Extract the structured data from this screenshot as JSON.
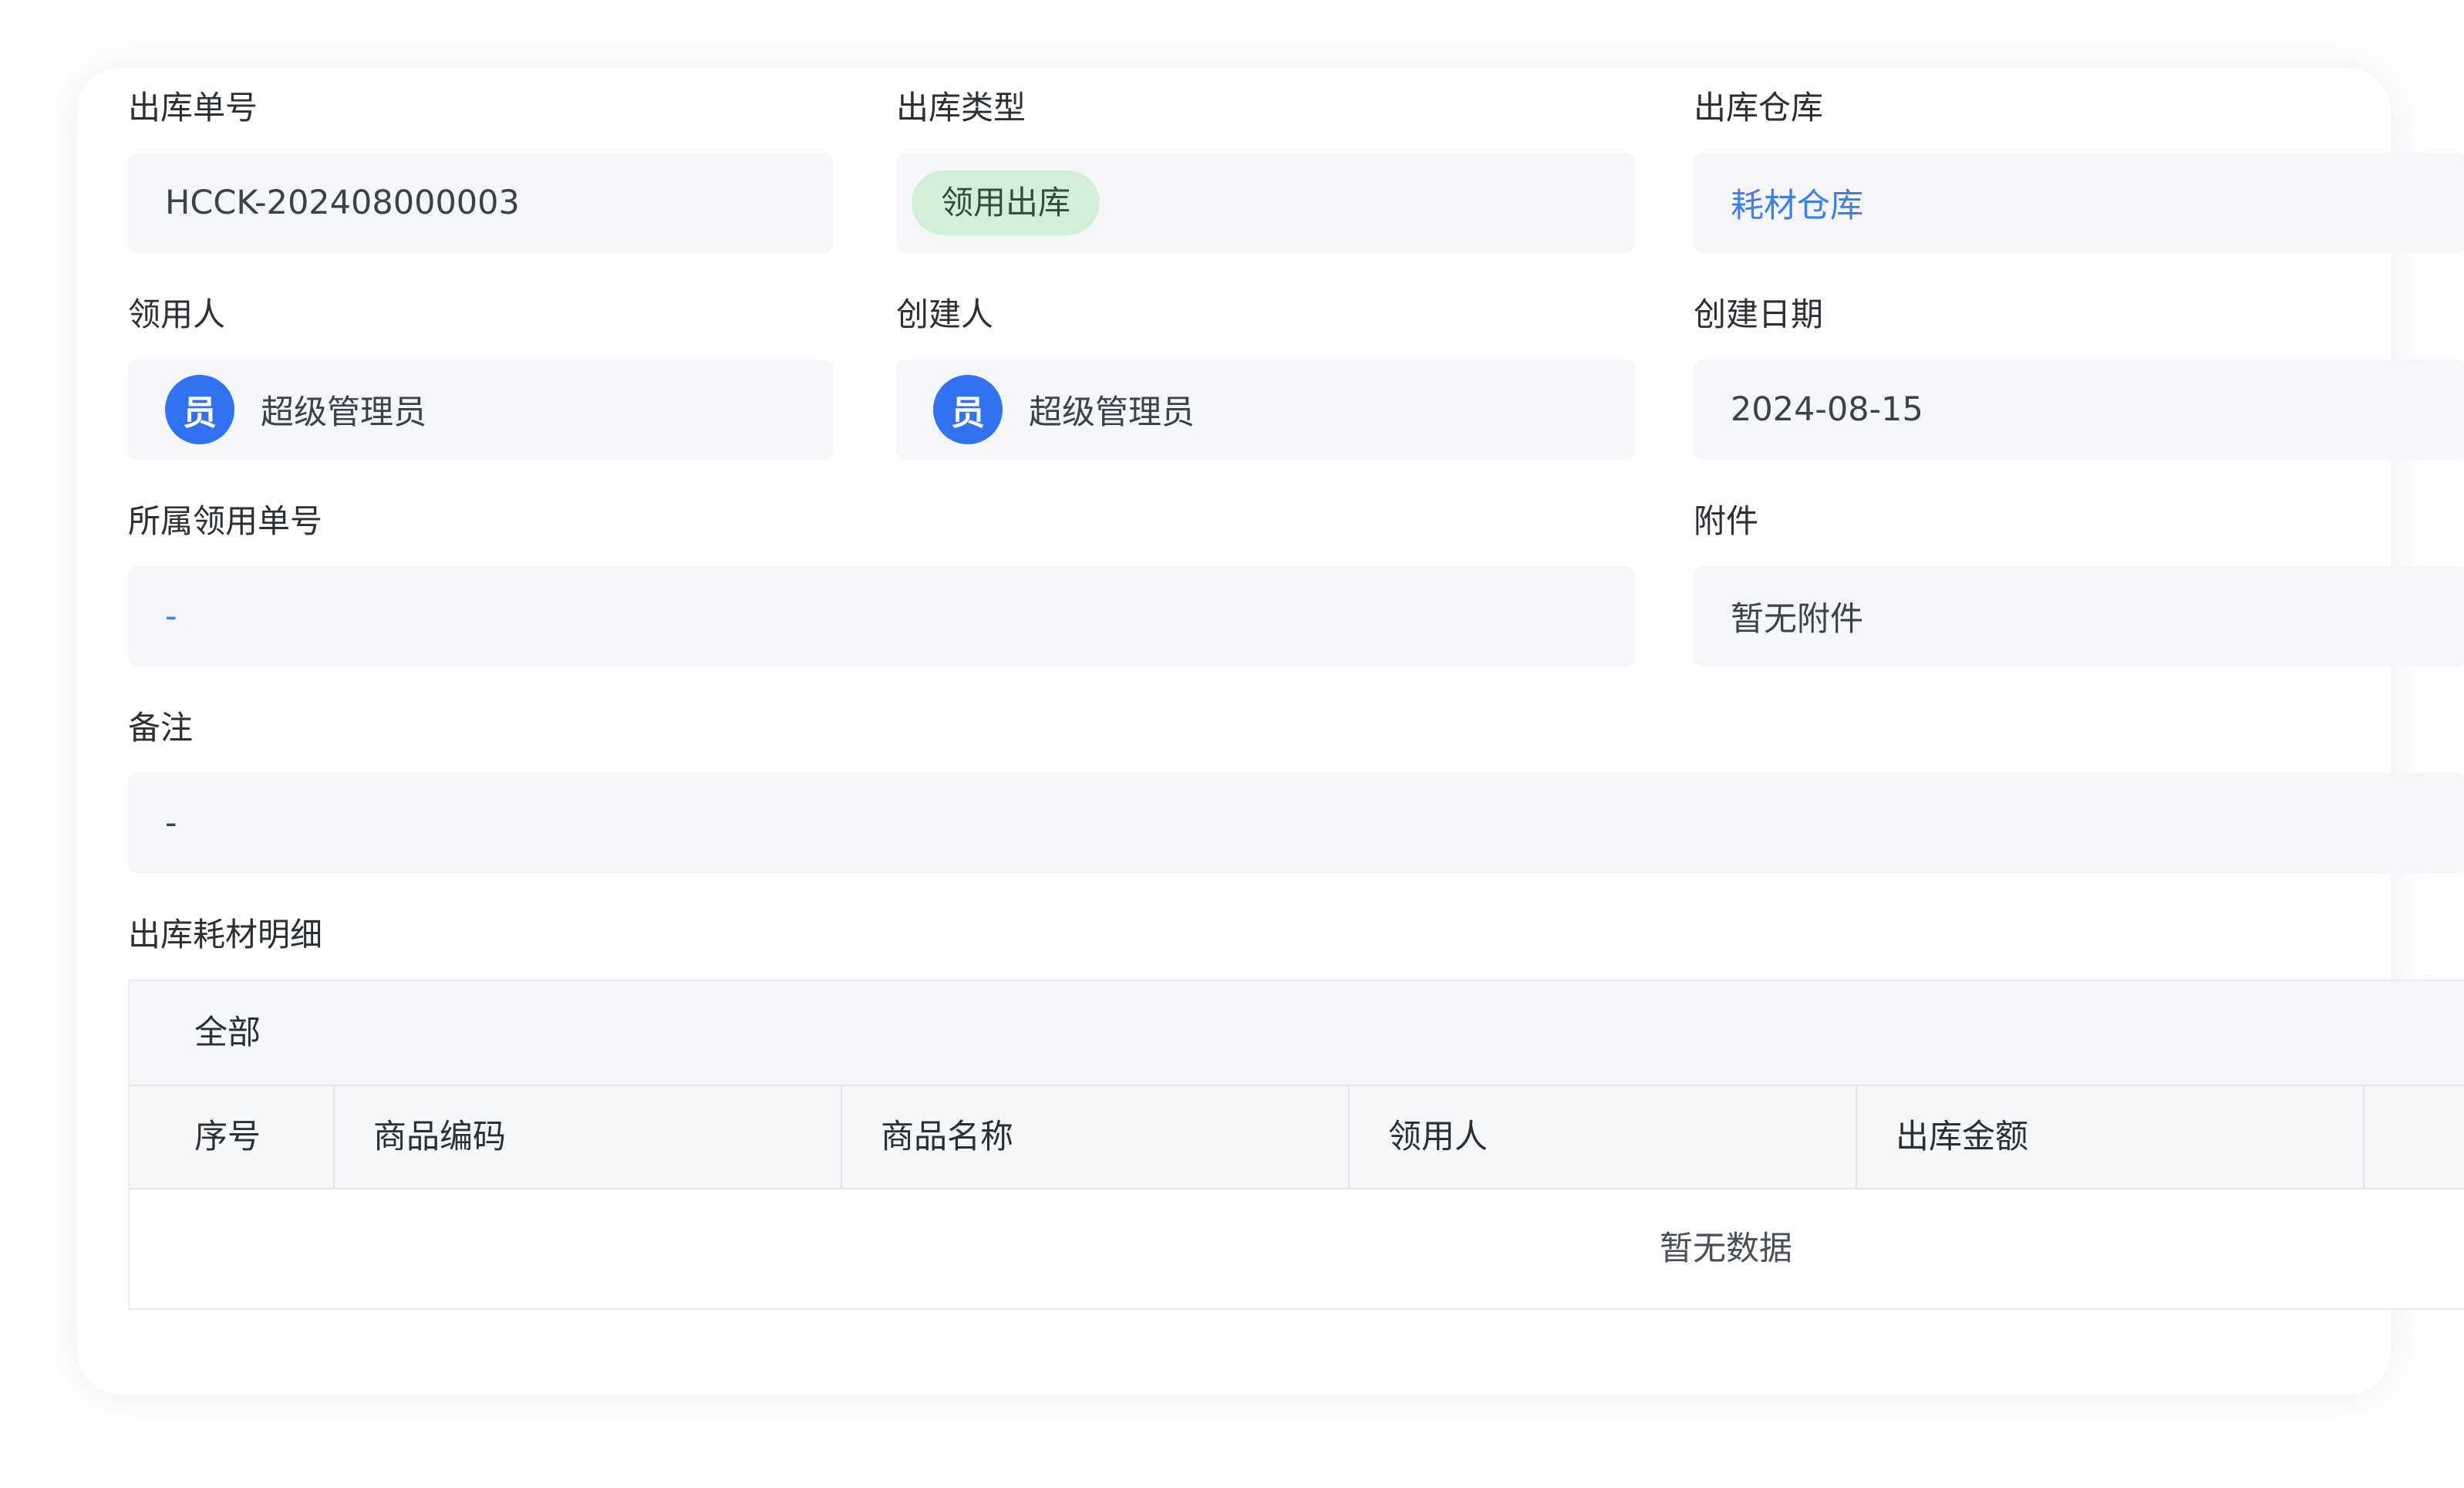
{
  "form": {
    "out_no": {
      "label": "出库单号",
      "value": "HCCK-202408000003"
    },
    "out_type": {
      "label": "出库类型",
      "value": "领用出库"
    },
    "warehouse": {
      "label": "出库仓库",
      "value": "耗材仓库"
    },
    "recipient": {
      "label": "领用人",
      "avatar": "员",
      "value": "超级管理员"
    },
    "creator": {
      "label": "创建人",
      "avatar": "员",
      "value": "超级管理员"
    },
    "created_date": {
      "label": "创建日期",
      "value": "2024-08-15"
    },
    "requisition_no": {
      "label": "所属领用单号",
      "value": "-"
    },
    "attachment": {
      "label": "附件",
      "value": "暂无附件"
    },
    "remark": {
      "label": "备注",
      "value": "-"
    }
  },
  "details": {
    "title": "出库耗材明细",
    "tabs": [
      "全部"
    ],
    "columns": [
      "序号",
      "商品编码",
      "商品名称",
      "领用人",
      "出库金额"
    ],
    "empty_text": "暂无数据"
  },
  "colors": {
    "accent": "#3b7ef6",
    "avatar": "#3371f3",
    "tag_bg": "#d2f0d8",
    "field_bg": "#f5f6fa"
  }
}
